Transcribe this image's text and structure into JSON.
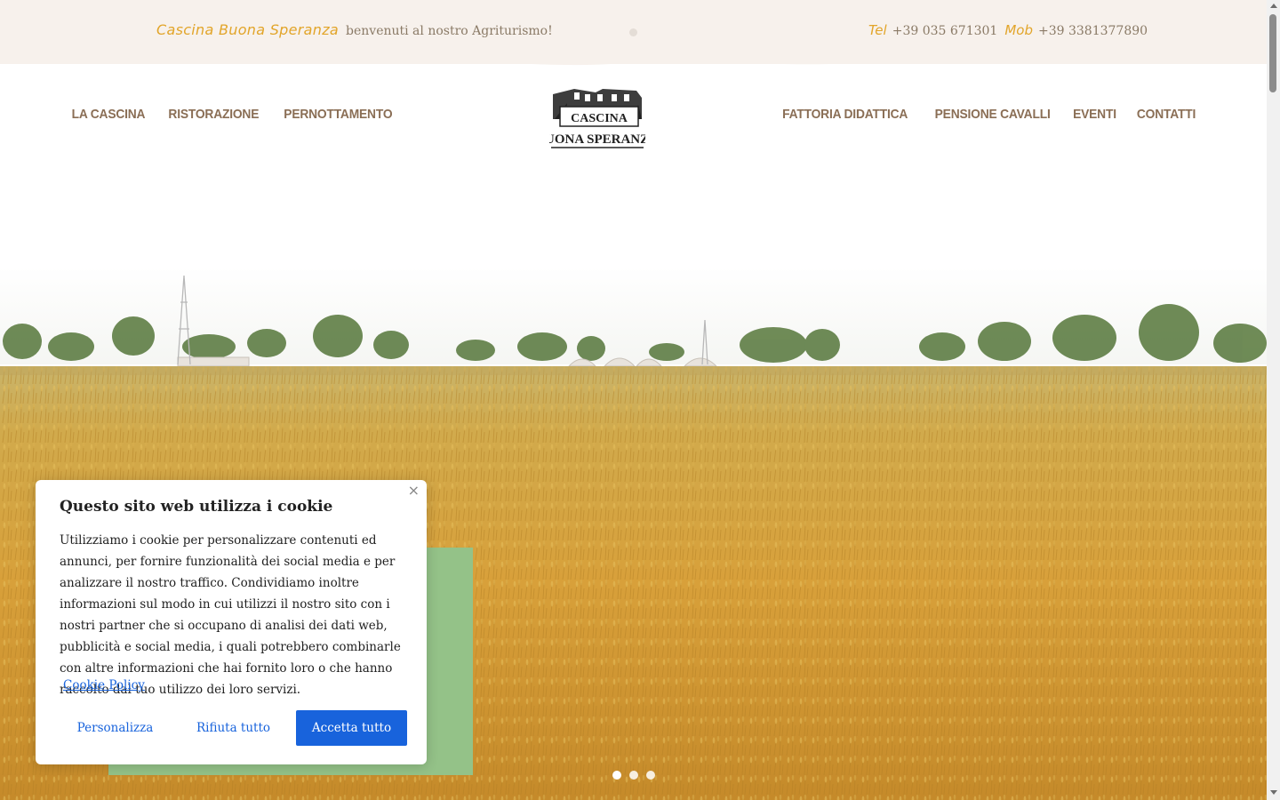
{
  "topbar": {
    "brand": "Cascina Buona Speranza",
    "welcome": "benvenuti al nostro Agriturismo!",
    "tel_label": "Tel",
    "tel_number": "+39 035 671301",
    "mob_label": "Mob",
    "mob_number": "+39 3381377890"
  },
  "nav": {
    "left": [
      "LA CASCINA",
      "RISTORAZIONE",
      "PERNOTTAMENTO"
    ],
    "right": [
      "FATTORIA DIDATTICA",
      "PENSIONE CAVALLI",
      "EVENTI",
      "CONTATTI"
    ]
  },
  "logo": {
    "line1": "CASCINA",
    "line2": "BUONA SPERANZA"
  },
  "colors": {
    "accent": "#e2a52a",
    "nav_text": "#8a6e55",
    "topbar_bg": "#f7f1ec",
    "green_box": "#94c288",
    "cookie_button": "#1863dc"
  },
  "slider": {
    "slides": 3,
    "active": 1
  },
  "cookie": {
    "title": "Questo sito web utilizza i cookie",
    "body": "Utilizziamo i cookie per personalizzare contenuti ed annunci, per fornire funzionalità dei social media e per analizzare il nostro traffico. Condividiamo inoltre informazioni sul modo in cui utilizzi il nostro sito con i nostri partner che si occupano di analisi dei dati web, pubblicità e social media, i quali potrebbero combinarle con altre informazioni che hai fornito loro o che hanno raccolto dal tuo utilizzo dei loro servizi.",
    "policy_link": "Cookie Policy",
    "close_icon": "close-icon",
    "buttons": {
      "customize": "Personalizza",
      "reject": "Rifiuta tutto",
      "accept": "Accetta tutto"
    }
  }
}
